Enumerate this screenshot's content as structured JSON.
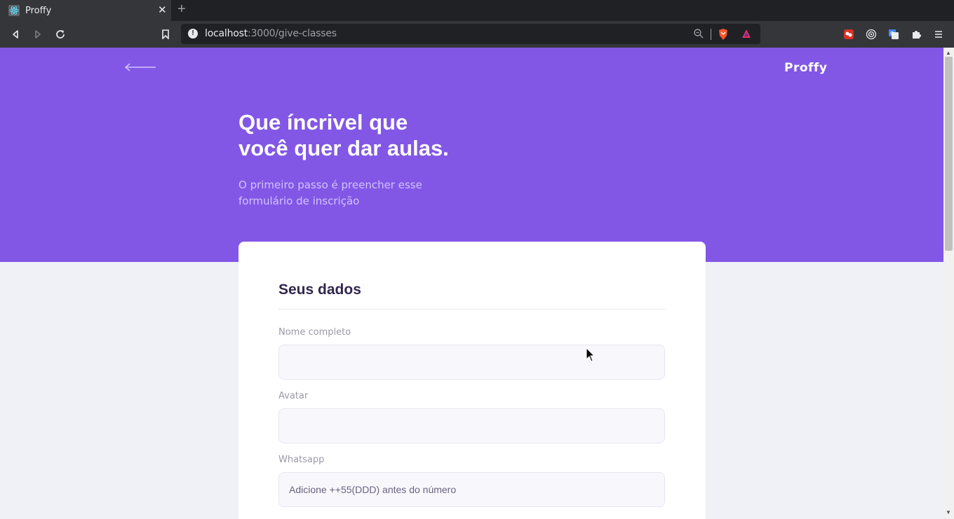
{
  "browser": {
    "tab_title": "Proffy",
    "tab_close": "✕",
    "new_tab": "+",
    "url_host": "localhost",
    "url_path": ":3000/give-classes"
  },
  "header": {
    "brand": "Proffy",
    "title_line1": "Que íncrivel que",
    "title_line2": "você quer dar aulas.",
    "subtitle_line1": "O primeiro passo é preencher esse",
    "subtitle_line2": "formulário de inscrição"
  },
  "form": {
    "legend": "Seus dados",
    "fields": [
      {
        "label": "Nome completo",
        "value": "",
        "placeholder": ""
      },
      {
        "label": "Avatar",
        "value": "",
        "placeholder": ""
      },
      {
        "label": "Whatsapp",
        "value": "",
        "placeholder": "Adicione ++55(DDD) antes do número"
      }
    ]
  },
  "colors": {
    "primary": "#8257e5",
    "background": "#f0f0f7",
    "title_dark": "#32264d",
    "label": "#9c98a6"
  }
}
